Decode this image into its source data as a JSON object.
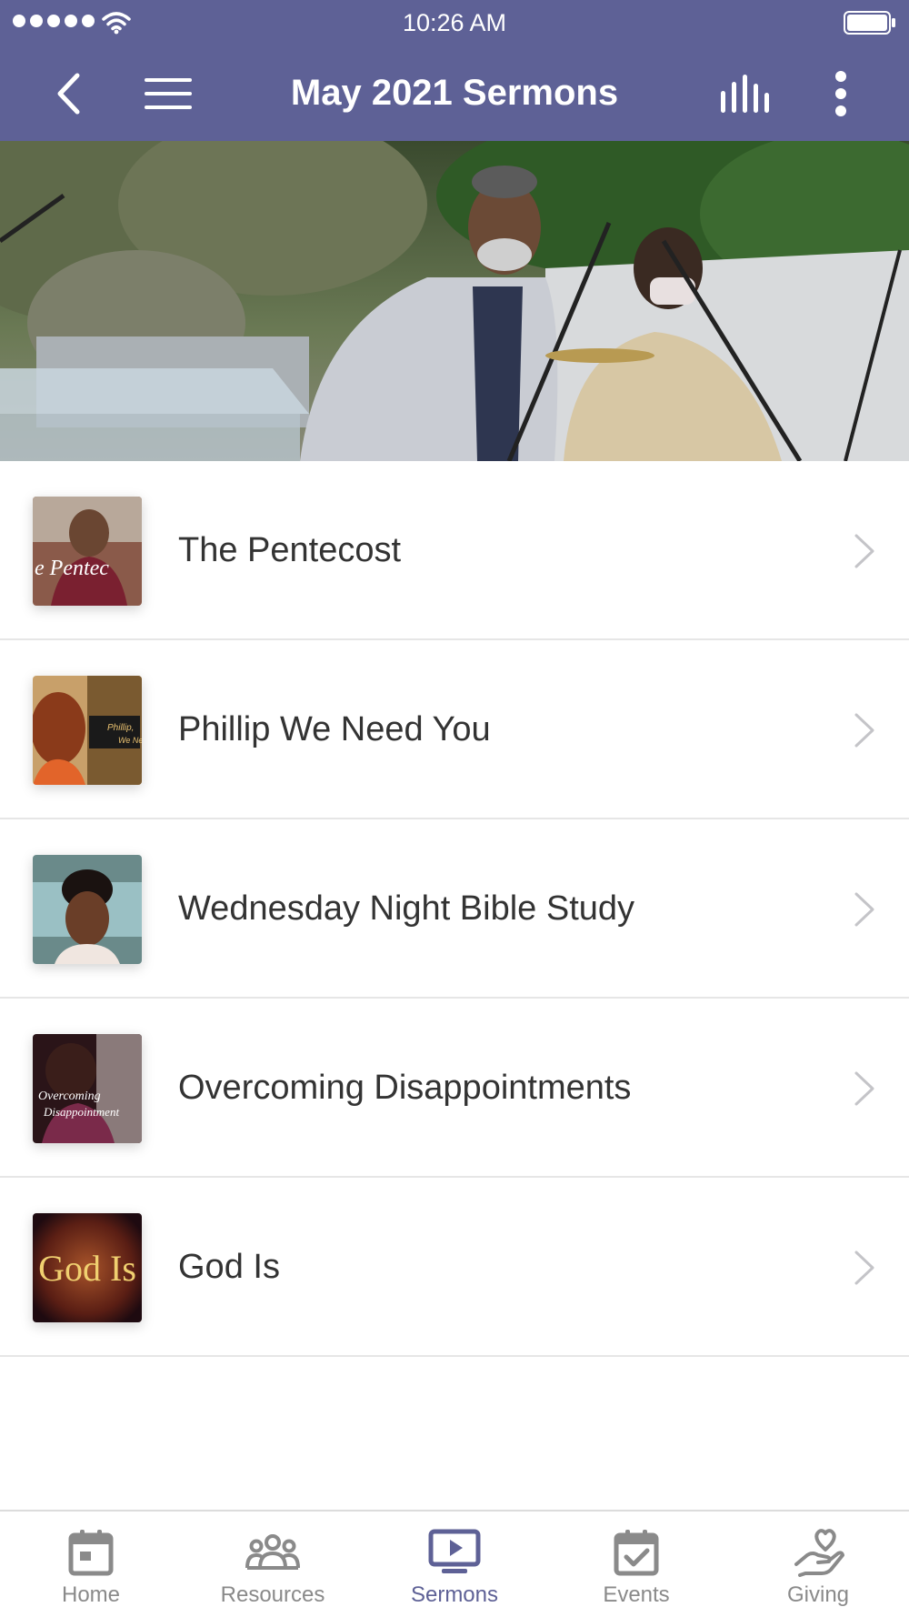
{
  "status_bar": {
    "time": "10:26 AM"
  },
  "nav": {
    "title": "May 2021 Sermons"
  },
  "sermons": [
    {
      "title": "The Pentecost",
      "thumb_text": "e Pentec"
    },
    {
      "title": "Phillip We Need You",
      "thumb_text_1": "Phillip,",
      "thumb_text_2": "We Nee"
    },
    {
      "title": "Wednesday Night Bible Study"
    },
    {
      "title": "Overcoming Disappointments",
      "thumb_text_1": "Overcoming",
      "thumb_text_2": "Disappointment"
    },
    {
      "title": "God Is",
      "thumb_text": "God Is"
    }
  ],
  "tabs": [
    {
      "label": "Home",
      "icon": "calendar-icon"
    },
    {
      "label": "Resources",
      "icon": "people-icon"
    },
    {
      "label": "Sermons",
      "icon": "tv-play-icon",
      "active": true
    },
    {
      "label": "Events",
      "icon": "calendar-check-icon"
    },
    {
      "label": "Giving",
      "icon": "hand-heart-icon"
    }
  ],
  "colors": {
    "accent": "#5e6196",
    "tab_inactive": "#8a8a8a",
    "text": "#333333"
  }
}
